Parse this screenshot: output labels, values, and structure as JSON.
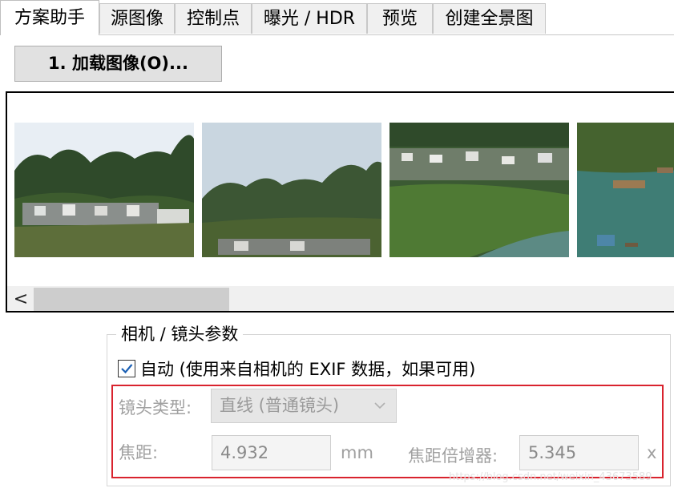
{
  "tabs": [
    {
      "label": "方案助手",
      "active": true
    },
    {
      "label": "源图像",
      "active": false
    },
    {
      "label": "控制点",
      "active": false
    },
    {
      "label": "曝光 / HDR",
      "active": false
    },
    {
      "label": "预览",
      "active": false
    },
    {
      "label": "创建全景图",
      "active": false
    }
  ],
  "load_button": "1. 加载图像(O)...",
  "thumbnails": [
    "mountain-village-photo",
    "mountain-sky-photo",
    "village-river-photo",
    "river-boats-photo"
  ],
  "scrollbar": {
    "left_arrow": "<"
  },
  "camera_group": {
    "title": "相机 / 镜头参数",
    "auto_checked": true,
    "auto_label": "自动 (使用来自相机的 EXIF 数据，如果可用)",
    "lens_type_label": "镜头类型:",
    "lens_type_value": "直线 (普通镜头)",
    "focal_length_label": "焦距:",
    "focal_length_value": "4.932",
    "focal_length_unit": "mm",
    "multiplier_label": "焦距倍增器:",
    "multiplier_value": "5.345",
    "multiplier_unit": "x"
  },
  "colors": {
    "highlight": "#d9232e",
    "tab_bg": "#f0f0f0"
  },
  "watermark": "https://blog.csdn.net/weixin_43673589"
}
